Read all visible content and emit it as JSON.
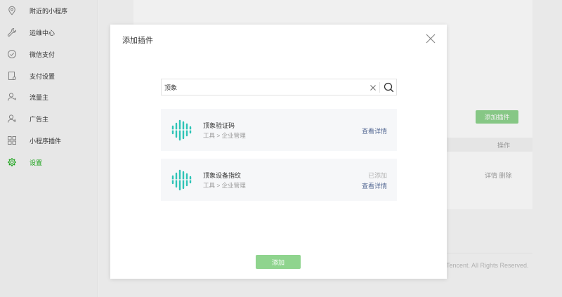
{
  "sidebar": {
    "items": [
      {
        "label": "附近的小程序",
        "icon": "location-pin-icon",
        "active": false
      },
      {
        "label": "运维中心",
        "icon": "wrench-icon",
        "active": false
      },
      {
        "label": "微信支付",
        "icon": "payment-icon",
        "active": false
      },
      {
        "label": "支付设置",
        "icon": "payment-settings-icon",
        "active": false
      },
      {
        "label": "流量主",
        "icon": "user-icon",
        "active": false
      },
      {
        "label": "广告主",
        "icon": "advertiser-icon",
        "active": false
      },
      {
        "label": "小程序插件",
        "icon": "grid-icon",
        "active": false
      },
      {
        "label": "设置",
        "icon": "gear-icon",
        "active": true
      }
    ]
  },
  "background": {
    "add_button_label": "添加插件",
    "table_op_header": "操作",
    "row_actions": "详情 删除",
    "copyright": "Tencent. All Rights Reserved."
  },
  "modal": {
    "title": "添加插件",
    "search": {
      "value": "顶象",
      "placeholder": ""
    },
    "results": [
      {
        "name": "顶象验证码",
        "category": "工具 > 企业管理",
        "status": "",
        "detail_label": "查看详情"
      },
      {
        "name": "顶象设备指纹",
        "category": "工具 > 企业管理",
        "status": "已添加",
        "detail_label": "查看详情"
      }
    ],
    "add_button_label": "添加"
  },
  "colors": {
    "accent": "#1aad19",
    "button_disabled": "#8fd48e",
    "link": "#576b95",
    "logo_teal": "#2ec4b6"
  }
}
